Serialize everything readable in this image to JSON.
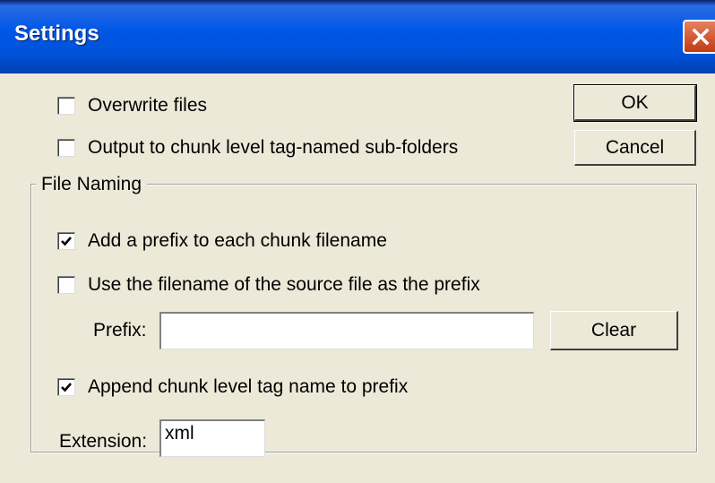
{
  "window": {
    "title": "Settings"
  },
  "options": {
    "overwrite_files": {
      "label": "Overwrite files",
      "checked": false
    },
    "output_subfolders": {
      "label": "Output to chunk level tag-named sub-folders",
      "checked": false
    }
  },
  "buttons": {
    "ok": "OK",
    "cancel": "Cancel",
    "clear": "Clear"
  },
  "file_naming": {
    "group_label": "File Naming",
    "add_prefix": {
      "label": "Add a prefix to each chunk filename",
      "checked": true
    },
    "use_source_filename": {
      "label": "Use the filename of the source file as the prefix",
      "checked": false
    },
    "prefix_label": "Prefix:",
    "prefix_value": "",
    "append_tag_name": {
      "label": "Append chunk level tag name to prefix",
      "checked": true
    },
    "extension_label": "Extension:",
    "extension_value": "xml"
  }
}
